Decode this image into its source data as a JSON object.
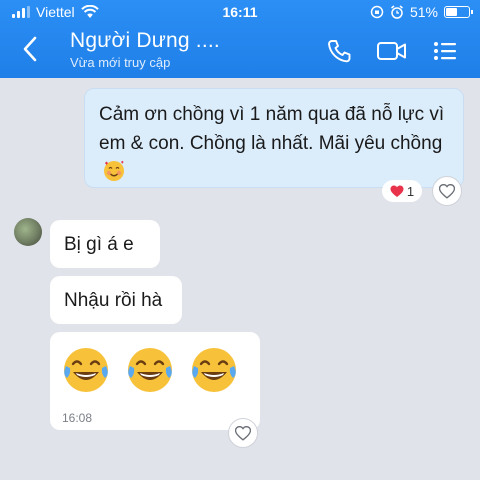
{
  "status_bar": {
    "carrier": "Viettel",
    "time": "16:11",
    "battery": "51%",
    "battery_level": 0.51
  },
  "header": {
    "back_icon": "chevron-left-icon",
    "contact_name": "Người Dưng ....",
    "contact_status": "Vừa mới truy cập",
    "call_icon": "phone-icon",
    "video_icon": "video-camera-icon",
    "menu_icon": "menu-list-icon"
  },
  "messages": [
    {
      "direction": "outgoing",
      "text": "Cảm ơn chồng vì 1 năm qua đã nỗ lực vì em & con. Chồng là nhất. Mãi yêu chồng",
      "emoji": "smiling-face-with-hearts",
      "reaction_count": "1",
      "reaction_icon": "red-heart-icon"
    },
    {
      "direction": "incoming",
      "text": "Bị gì á e"
    },
    {
      "direction": "incoming",
      "text": "Nhậu rồi hà"
    },
    {
      "direction": "incoming",
      "emoji": [
        "tears-of-joy",
        "tears-of-joy",
        "tears-of-joy"
      ],
      "time": "16:08"
    }
  ],
  "colors": {
    "header_blue": "#2188f0",
    "background": "#e1e3ea",
    "outgoing_bubble": "#dbecfb",
    "incoming_bubble": "#ffffff",
    "heart_red": "#e8334a"
  }
}
